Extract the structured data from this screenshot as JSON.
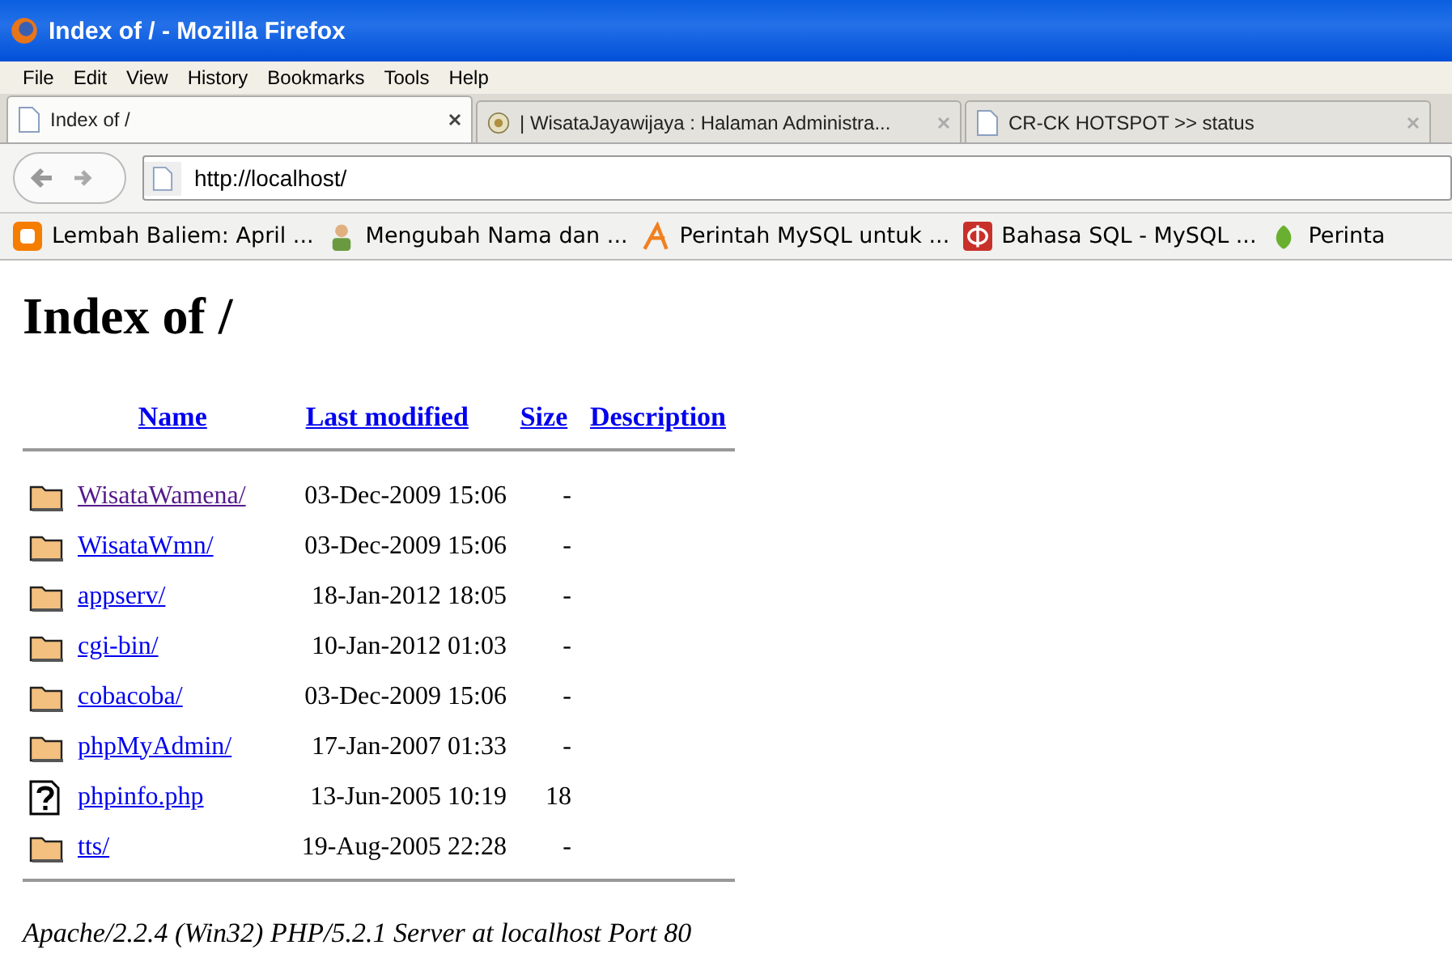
{
  "window": {
    "title": "Index of / - Mozilla Firefox"
  },
  "menu": [
    "File",
    "Edit",
    "View",
    "History",
    "Bookmarks",
    "Tools",
    "Help"
  ],
  "tabs": [
    {
      "label": "Index of /",
      "selected": true
    },
    {
      "label": "| WisataJayawijaya : Halaman Administra...",
      "selected": false
    },
    {
      "label": "CR-CK HOTSPOT >> status",
      "selected": false
    }
  ],
  "address": {
    "value": "http://localhost/"
  },
  "bookmarks": [
    "Lembah Baliem: April ...",
    "Mengubah Nama dan ...",
    "Perintah MySQL untuk ...",
    "Bahasa SQL - MySQL ...",
    "Perinta"
  ],
  "page": {
    "heading": "Index of /",
    "columns": [
      "Name",
      "Last modified",
      "Size",
      "Description"
    ],
    "rows": [
      {
        "kind": "folder",
        "name": "WisataWamena/",
        "visited": true,
        "modified": "03-Dec-2009 15:06",
        "size": "-"
      },
      {
        "kind": "folder",
        "name": "WisataWmn/",
        "visited": false,
        "modified": "03-Dec-2009 15:06",
        "size": "-"
      },
      {
        "kind": "folder",
        "name": "appserv/",
        "visited": false,
        "modified": "18-Jan-2012 18:05",
        "size": "-"
      },
      {
        "kind": "folder",
        "name": "cgi-bin/",
        "visited": false,
        "modified": "10-Jan-2012 01:03",
        "size": "-"
      },
      {
        "kind": "folder",
        "name": "cobacoba/",
        "visited": false,
        "modified": "03-Dec-2009 15:06",
        "size": "-"
      },
      {
        "kind": "folder",
        "name": "phpMyAdmin/",
        "visited": false,
        "modified": "17-Jan-2007 01:33",
        "size": "-"
      },
      {
        "kind": "unknown",
        "name": "phpinfo.php",
        "visited": false,
        "modified": "13-Jun-2005 10:19",
        "size": "18"
      },
      {
        "kind": "folder",
        "name": "tts/",
        "visited": false,
        "modified": "19-Aug-2005 22:28",
        "size": "-"
      }
    ],
    "footer": "Apache/2.2.4 (Win32) PHP/5.2.1 Server at localhost Port 80"
  }
}
